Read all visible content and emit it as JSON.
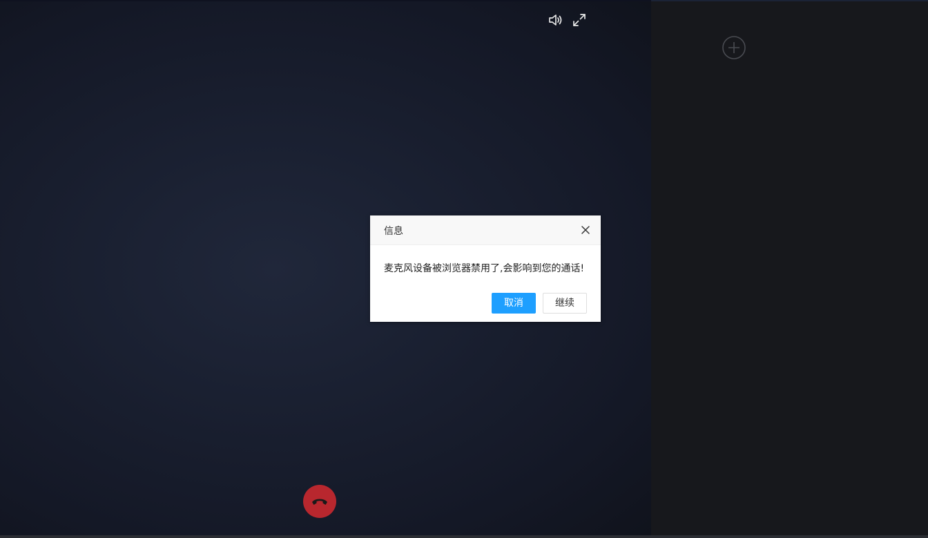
{
  "icons": {
    "speaker": "speaker-icon",
    "fullscreen": "fullscreen-icon",
    "add": "plus-circle-icon",
    "hangup": "phone-hangup-icon",
    "close": "close-icon"
  },
  "colors": {
    "accent": "#1e9fff",
    "hangup": "#b8272e",
    "video_bg": "#1a2031",
    "panel_bg": "#17181c"
  },
  "dialog": {
    "title": "信息",
    "message": "麦克风设备被浏览器禁用了,会影响到您的通话!",
    "primary_label": "取消",
    "secondary_label": "继续"
  }
}
